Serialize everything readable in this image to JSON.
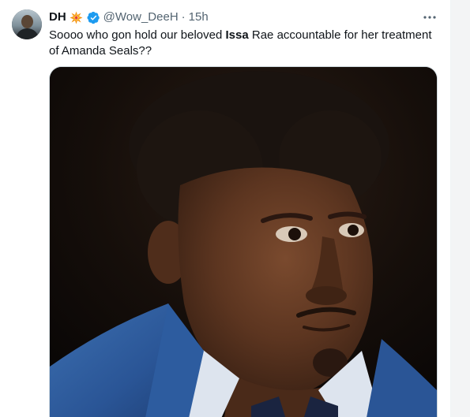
{
  "author": {
    "display_name": "DH",
    "name_emoji": "collision-emoji",
    "verified": true,
    "handle": "@Wow_DeeH",
    "separator": "·",
    "timestamp": "15h"
  },
  "tweet": {
    "text_before": "Soooo who gon hold our beloved ",
    "text_bold": "Issa",
    "text_after": " Rae accountable for her treatment of Amanda Seals??"
  },
  "media": {
    "type": "photo",
    "description_icon": "person-portrait-photo"
  },
  "icons": {
    "more": "more-horizontal-icon",
    "verified": "verified-badge-icon",
    "avatar": "profile-avatar"
  },
  "colors": {
    "primary_text": "#0f1419",
    "secondary_text": "#536471",
    "verified_blue": "#1d9bf0",
    "border": "#cfd9de"
  }
}
